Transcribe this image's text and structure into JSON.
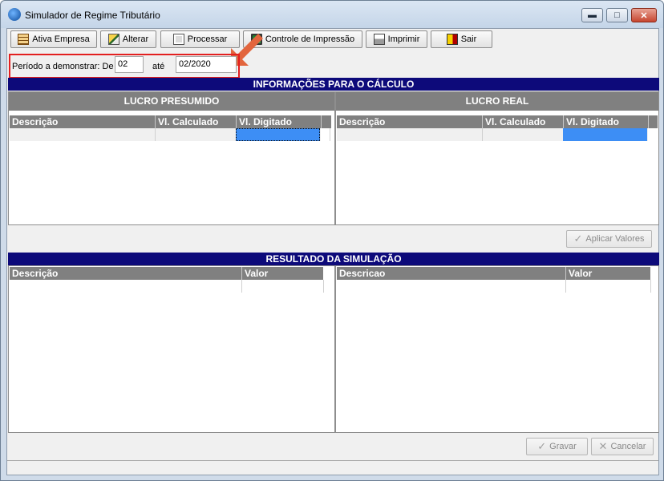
{
  "window": {
    "title": "Simulador de Regime Tributário",
    "min_glyph": "▬",
    "max_glyph": "□",
    "close_glyph": "✕"
  },
  "toolbar": {
    "ativa_empresa": "Ativa Empresa",
    "alterar": "Alterar",
    "processar": "Processar",
    "controle_impressao": "Controle de Impressão",
    "imprimir": "Imprimir",
    "sair": "Sair"
  },
  "period": {
    "label": "Período a demonstrar: De",
    "from_value": "02",
    "to_label": "até",
    "to_value": "02/2020"
  },
  "info_section": {
    "title": "INFORMAÇÕES PARA O CÁLCULO",
    "presumido": {
      "title": "LUCRO PRESUMIDO",
      "columns": [
        "Descrição",
        "Vl. Calculado",
        "Vl. Digitado"
      ]
    },
    "real": {
      "title": "LUCRO REAL",
      "columns": [
        "Descrição",
        "Vl. Calculado",
        "Vl. Digitado"
      ]
    },
    "apply_button": "Aplicar Valores"
  },
  "result_section": {
    "title": "RESULTADO DA SIMULAÇÃO",
    "left_columns": [
      "Descrição",
      "Valor"
    ],
    "right_columns": [
      "Descricao",
      "Valor"
    ]
  },
  "footer": {
    "gravar": "Gravar",
    "cancelar": "Cancelar"
  },
  "colors": {
    "section_bar": "#0d0a7a",
    "highlight_box": "#e32020",
    "arrow": "#e2653d",
    "selected_cell": "#3d8ef5"
  },
  "icons": [
    "app-icon",
    "grid-icon",
    "edit-icon",
    "calculator-icon",
    "monitor-icon",
    "printer-icon",
    "exit-icon",
    "checkmark-icon",
    "cancel-icon",
    "arrow-annotation"
  ]
}
